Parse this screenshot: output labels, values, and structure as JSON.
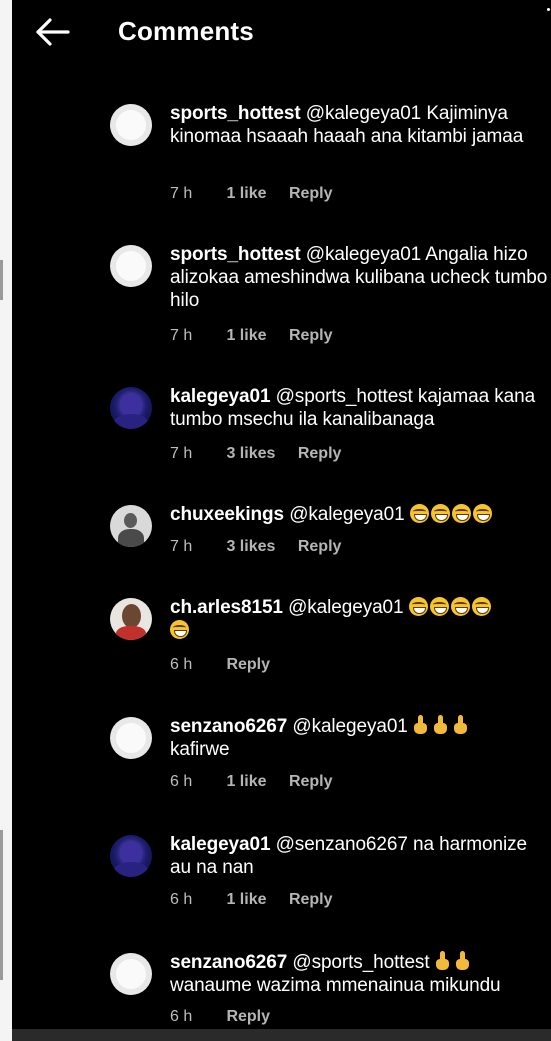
{
  "header": {
    "title": "Comments",
    "back_icon": "arrow-left-icon"
  },
  "comments": [
    {
      "username": "sports_hottest",
      "avatar": "default-avatar",
      "mention": "@kalegeya01",
      "text_line1": " Kajiminya",
      "text_rest": "kinomaa hsaaah haaah ana kitambi jamaa",
      "time": "7 h",
      "likes": "1 like",
      "reply": "Reply"
    },
    {
      "username": "sports_hottest",
      "avatar": "default-avatar",
      "mention": "@kalegeya01",
      "text_line1": " Angalia",
      "text_rest": "hizo alizokaa ameshindwa kulibana ucheck tumbo hilo",
      "time": "7 h",
      "likes": "1 like",
      "reply": "Reply"
    },
    {
      "username": "kalegeya01",
      "avatar": "purple-avatar",
      "mention": "@sports_hottest",
      "text_line1": " kajamaa",
      "text_rest": "kana tumbo msechu ila kanalibanaga",
      "time": "7 h",
      "likes": "3 likes",
      "reply": "Reply"
    },
    {
      "username": "chuxeekings",
      "avatar": "gray-avatar",
      "mention": "@kalegeya01",
      "emoji": "grinning-face-emoji",
      "emoji_count": 4,
      "time": "7 h",
      "likes": "3 likes",
      "reply": "Reply"
    },
    {
      "username": "ch.arles8151",
      "avatar": "photo-avatar",
      "mention": "@kalegeya01",
      "emoji": "grinning-face-emoji",
      "emoji_count": 5,
      "time": "6 h",
      "reply": "Reply"
    },
    {
      "username": "senzano6267",
      "avatar": "default-avatar",
      "mention": "@kalegeya01",
      "emoji": "pointing-up-hand-emoji",
      "emoji_count": 3,
      "text_rest": "kafirwe",
      "time": "6 h",
      "likes": "1 like",
      "reply": "Reply"
    },
    {
      "username": "kalegeya01",
      "avatar": "purple-avatar",
      "mention": "@senzano6267",
      "text_line1": " na",
      "text_rest": "harmonize au na nan",
      "time": "6 h",
      "likes": "1 like",
      "reply": "Reply"
    },
    {
      "username": "senzano6267",
      "avatar": "default-avatar",
      "mention": "@sports_hottest",
      "emoji": "pointing-up-hand-emoji",
      "emoji_count": 2,
      "text_rest": "wanaume wazima mmenainua mikundu",
      "time": "6 h",
      "reply": "Reply"
    }
  ],
  "colors": {
    "background": "#000000",
    "text": "#ffffff",
    "meta_text": "#b5b5b5"
  }
}
